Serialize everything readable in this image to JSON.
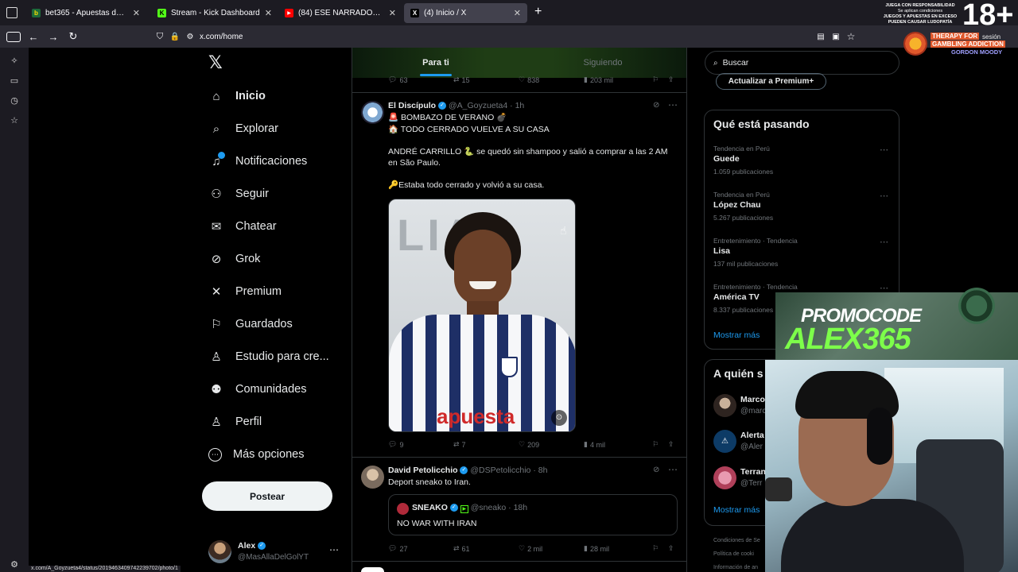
{
  "browser": {
    "tabs": [
      {
        "label": "bet365 - Apuestas deportivas e",
        "favicon_color": "#1d6b3a",
        "favicon_glyph": "b"
      },
      {
        "label": "Stream - Kick Dashboard",
        "favicon_color": "#53fc18",
        "favicon_glyph": "K"
      },
      {
        "label": "(84) ESE NARRADOR 😂 #perú",
        "favicon_color": "#ff0000",
        "favicon_glyph": "▶"
      },
      {
        "label": "(4) Inicio / X",
        "favicon_color": "#ffffff",
        "favicon_glyph": "X"
      }
    ],
    "url": "x.com/home",
    "status_url": "x.com/A_Goyzueta4/status/2019463409742239702/photo/1"
  },
  "overlay": {
    "legal_text_1": "JUEGA CON RESPONSABILIDAD",
    "legal_text_2": "Se aplican condiciones",
    "legal_text_3": "JUEGOS Y APUESTAS EN EXCESO",
    "legal_text_4": "PUEDEN CAUSAR LUDOPATÍA",
    "age_badge": "18+",
    "therapy_line_1": "THERAPY FOR",
    "therapy_line_2": "GAMBLING ADDICTION",
    "therapy_line_3": "GORDON MOODY",
    "session_text": "sesión",
    "promo_title": "PROMOCODE",
    "promo_code": "ALEX365"
  },
  "nav": {
    "items": [
      {
        "label": "Inicio",
        "icon": "home-icon",
        "glyph": "⌂"
      },
      {
        "label": "Explorar",
        "icon": "search-icon",
        "glyph": "⌕"
      },
      {
        "label": "Notificaciones",
        "icon": "bell-icon",
        "glyph": "🔔"
      },
      {
        "label": "Seguir",
        "icon": "follow-icon",
        "glyph": "⚇"
      },
      {
        "label": "Chatear",
        "icon": "mail-icon",
        "glyph": "✉"
      },
      {
        "label": "Grok",
        "icon": "grok-icon",
        "glyph": "⊘"
      },
      {
        "label": "Premium",
        "icon": "x-icon",
        "glyph": "✕"
      },
      {
        "label": "Guardados",
        "icon": "bookmark-icon",
        "glyph": "⚑"
      },
      {
        "label": "Estudio para cre...",
        "icon": "studio-icon",
        "glyph": "♙"
      },
      {
        "label": "Comunidades",
        "icon": "communities-icon",
        "glyph": "⚉"
      },
      {
        "label": "Perfil",
        "icon": "profile-icon",
        "glyph": "♙"
      },
      {
        "label": "Más opciones",
        "icon": "more-icon",
        "glyph": "⋯"
      }
    ],
    "notifications_badge_color": "#1d9bf0",
    "post_label": "Postear",
    "account_name": "Alex",
    "account_handle": "@MasAllaDelGolYT"
  },
  "feed": {
    "tabs": [
      "Para ti",
      "Siguiendo"
    ],
    "prev_actions": {
      "replies": "63",
      "reposts": "15",
      "likes": "838",
      "views": "203 mil"
    },
    "tweet1": {
      "name": "El Discípulo",
      "handle": "@A_Goyzueta4",
      "time": "1h",
      "line1": "🚨 BOMBAZO DE VERANO 💣",
      "line2": "🏠 TODO CERRADO VUELVE A SU CASA",
      "line3": "ANDRÉ CARRILLO 🐍 se quedó sin shampoo y salió a comprar a las 2 AM",
      "line4": "en São Paulo.",
      "line5": "🔑Estaba todo cerrado y volvió a su casa.",
      "image_caption": "apuesta",
      "replies": "9",
      "reposts": "7",
      "likes": "209",
      "views": "4 mil"
    },
    "tweet2": {
      "name": "David Petolicchio",
      "handle": "@DSPetolicchio",
      "time": "8h",
      "text": "Deport sneako to Iran.",
      "quote_name": "SNEAKO",
      "quote_handle": "@sneako",
      "quote_time": "18h",
      "quote_text": "NO WAR WITH IRAN",
      "replies": "27",
      "reposts": "61",
      "likes": "2 mil",
      "views": "28 mil"
    }
  },
  "right": {
    "search_placeholder": "Buscar",
    "premium_label": "Actualizar a Premium+",
    "trends_title": "Qué está pasando",
    "trends": [
      {
        "category": "Tendencia en Perú",
        "name": "Guede",
        "count": "1.059 publicaciones"
      },
      {
        "category": "Tendencia en Perú",
        "name": "López Chau",
        "count": "5.267 publicaciones"
      },
      {
        "category": "Entretenimiento · Tendencia",
        "name": "Lisa",
        "count": "137 mil publicaciones"
      },
      {
        "category": "Entretenimiento · Tendencia",
        "name": "América TV",
        "count": "8.337 publicaciones"
      }
    ],
    "show_more": "Mostrar más",
    "who_title": "A quién s",
    "who": [
      {
        "name": "Marco",
        "handle": "@marc"
      },
      {
        "name": "Alerta",
        "handle": "@Aler"
      },
      {
        "name": "Terran",
        "handle": "@Terr"
      }
    ],
    "show_more_2": "Mostrar más",
    "footer_1": "Condiciones de Se",
    "footer_2": "Política de cooki",
    "footer_3": "Información de an"
  }
}
